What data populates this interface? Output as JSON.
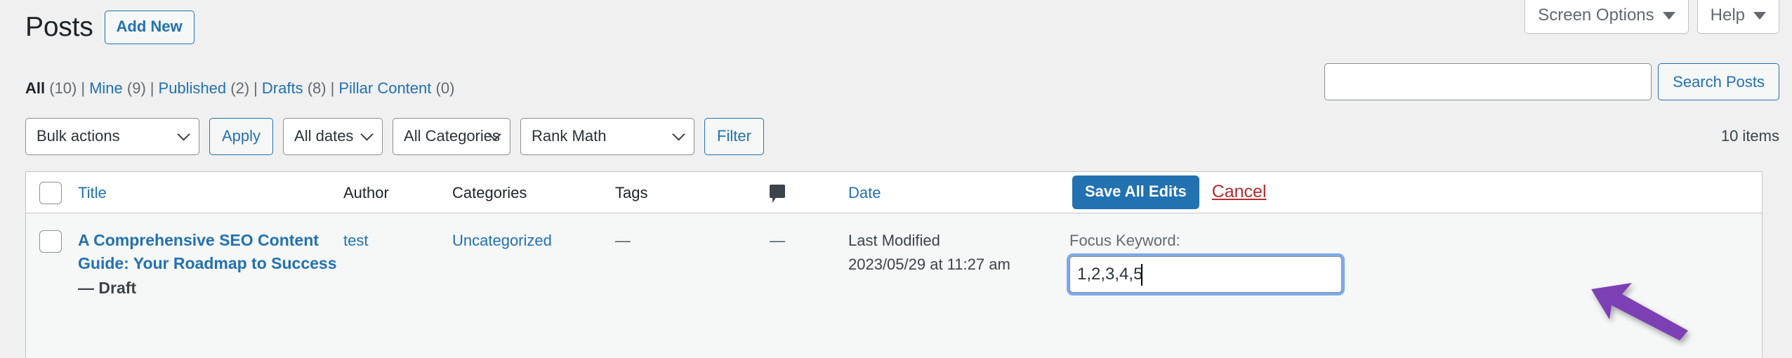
{
  "screen_meta": {
    "screen_options_label": "Screen Options",
    "help_label": "Help"
  },
  "header": {
    "page_title": "Posts",
    "add_new_label": "Add New"
  },
  "status_links": [
    {
      "label": "All",
      "count": "(10)",
      "current": true
    },
    {
      "label": "Mine",
      "count": "(9)",
      "current": false
    },
    {
      "label": "Published",
      "count": "(2)",
      "current": false
    },
    {
      "label": "Drafts",
      "count": "(8)",
      "current": false
    },
    {
      "label": "Pillar Content",
      "count": "(0)",
      "current": false
    }
  ],
  "search": {
    "value": "",
    "placeholder": "",
    "button_label": "Search Posts"
  },
  "tablenav": {
    "bulk_actions_value": "Bulk actions",
    "apply_label": "Apply",
    "dates_value": "All dates",
    "categories_value": "All Categories",
    "seo_filter_value": "Rank Math",
    "filter_label": "Filter",
    "items_count": "10 items"
  },
  "table": {
    "columns": {
      "title": "Title",
      "author": "Author",
      "categories": "Categories",
      "tags": "Tags",
      "comments_icon": "comment-bubble-icon",
      "date": "Date"
    },
    "header_actions": {
      "save_all_label": "Save All Edits",
      "cancel_label": "Cancel"
    },
    "rows": [
      {
        "title": "A Comprehensive SEO Content Guide: Your Roadmap to Success",
        "post_state": "— Draft",
        "author": "test",
        "categories": "Uncategorized",
        "tags": "—",
        "comments": "—",
        "date_label": "Last Modified",
        "date_value": "2023/05/29 at 11:27 am",
        "focus_keyword_label": "Focus Keyword:",
        "focus_keyword_value": "1,2,3,4,5"
      }
    ]
  },
  "colors": {
    "link_blue": "#2271b1",
    "primary_button": "#2271b1",
    "cancel_red": "#b32d2e",
    "page_background": "#f0f0f1",
    "row_background": "#f6f7f7",
    "focus_ring": "#7daaec",
    "annotation_arrow": "#7b3fb5"
  },
  "annotation": {
    "arrow_name": "purple-pointer-arrow",
    "points_at": "focus-keyword-input"
  }
}
